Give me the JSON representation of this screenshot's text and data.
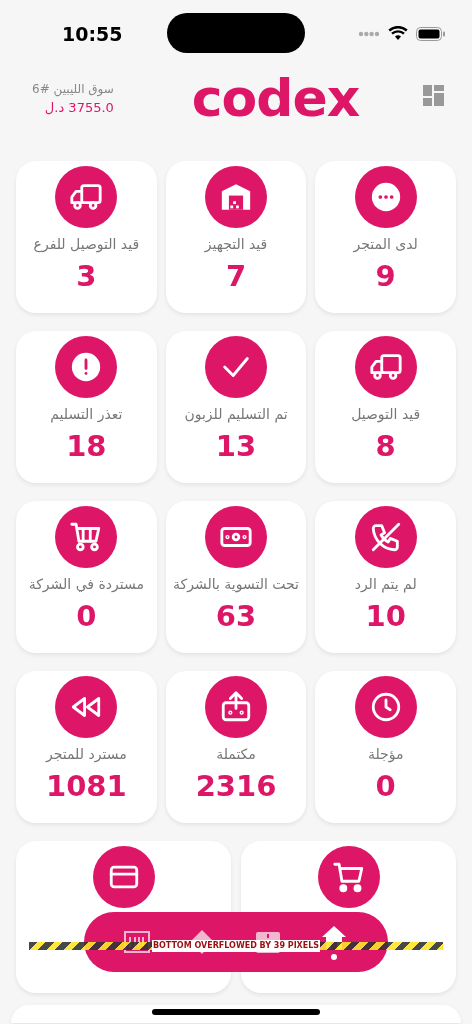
{
  "status_bar": {
    "time": "10:55"
  },
  "header": {
    "store_name": "سوق الليبين #6",
    "balance": "3755.0 د.ل",
    "logo": "codex"
  },
  "stats": [
    {
      "label": "لدى المتجر",
      "count": "9"
    },
    {
      "label": "قيد التجهيز",
      "count": "7"
    },
    {
      "label": "قيد التوصيل للفرع",
      "count": "3"
    },
    {
      "label": "قيد التوصيل",
      "count": "8"
    },
    {
      "label": "تم التسليم للزبون",
      "count": "13"
    },
    {
      "label": "تعذر التسليم",
      "count": "18"
    },
    {
      "label": "لم يتم الرد",
      "count": "10"
    },
    {
      "label": "تحت التسوية بالشركة",
      "count": "63"
    },
    {
      "label": "مستردة في الشركة",
      "count": "0"
    },
    {
      "label": "مؤجلة",
      "count": "0"
    },
    {
      "label": "مكتملة",
      "count": "2316"
    },
    {
      "label": "مسترد للمتجر",
      "count": "1081"
    }
  ],
  "wide_cards": [
    {
      "kind": "cart"
    },
    {
      "kind": "card"
    }
  ],
  "bottom_nav": {
    "items": [
      {
        "selected": true
      },
      {
        "selected": false
      },
      {
        "selected": false
      },
      {
        "selected": false
      }
    ]
  },
  "overflow_warning": "BOTTOM OVERFLOWED BY 39 PIXELS"
}
